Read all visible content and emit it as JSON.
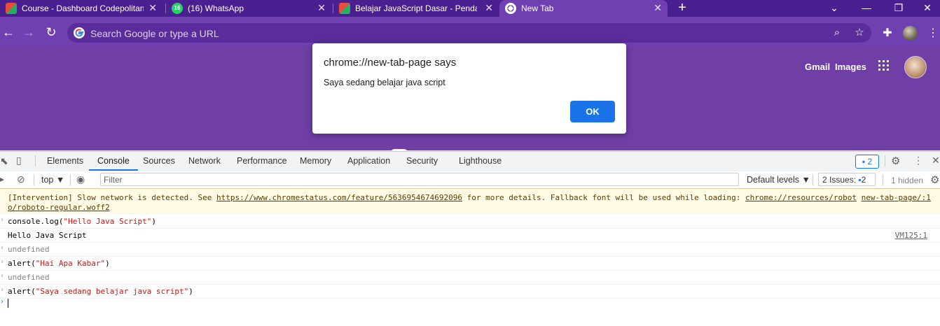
{
  "browser": {
    "tabs": [
      {
        "title": "Course - Dashboard Codepolitan",
        "favicon": "codepolitan-icon"
      },
      {
        "title": "(16) WhatsApp",
        "favicon": "whatsapp-icon",
        "badge": "16"
      },
      {
        "title": "Belajar JavaScript Dasar - Pendah",
        "favicon": "codepolitan-icon"
      },
      {
        "title": "New Tab",
        "favicon": "chrome-icon",
        "active": true
      }
    ],
    "omnibox_placeholder": "Search Google or type a URL"
  },
  "newtab": {
    "links": {
      "gmail": "Gmail",
      "images": "Images"
    }
  },
  "dialog": {
    "title": "chrome://new-tab-page says",
    "message": "Saya sedang belajar java script",
    "ok_label": "OK"
  },
  "devtools": {
    "tabs": [
      "Elements",
      "Console",
      "Sources",
      "Network",
      "Performance",
      "Memory",
      "Application",
      "Security",
      "Lighthouse"
    ],
    "active_tab": "Console",
    "messages_count": "2",
    "context": "top",
    "filter_placeholder": "Filter",
    "levels_label": "Default levels",
    "issues_label": "2 Issues:",
    "issues_count": "2",
    "hidden_label": "1 hidden"
  },
  "console": {
    "warning": {
      "prefix": "[Intervention] Slow network is detected. See ",
      "link1": "https://www.chromestatus.com/feature/5636954674692096",
      "middle": " for more details. Fallback font will be used while loading: ",
      "link2": "chrome://resources/robot",
      "link3": "new-tab-page/:1",
      "link4": "o/roboto-regular.woff2"
    },
    "entries": [
      {
        "fn": "console.log(",
        "arg": "\"Hello Java Script\"",
        "close": ")"
      },
      {
        "output": "Hello Java Script",
        "source": "VM125:1"
      },
      {
        "result": "undefined"
      },
      {
        "fn": "alert(",
        "arg": "\"Hai Apa Kabar\"",
        "close": ")"
      },
      {
        "result": "undefined"
      },
      {
        "fn": "alert(",
        "arg": "\"Saya sedang belajar java script\"",
        "close": ")"
      }
    ]
  },
  "colors": {
    "tabstrip": "#4a1f8f",
    "toolbar": "#7140b0",
    "page": "#6f3fa6",
    "accent": "#1a73e8",
    "string": "#c41a16"
  }
}
